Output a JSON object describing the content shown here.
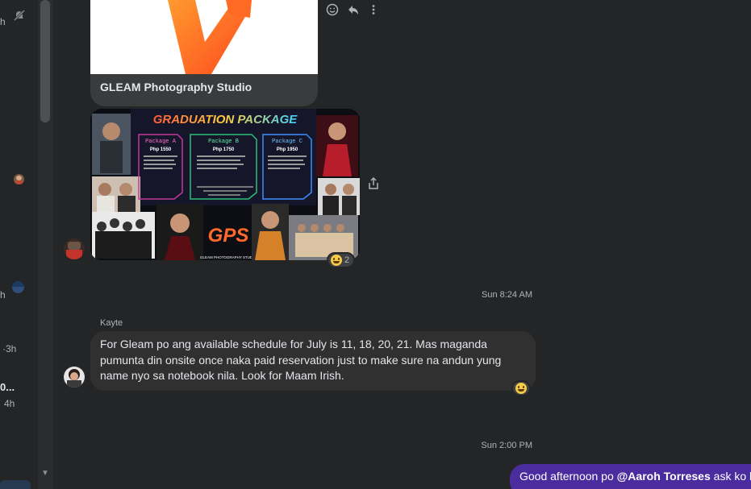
{
  "left_panel": {
    "items": [
      {
        "time": "h"
      },
      {
        "time": "h"
      },
      {
        "time": "·3h"
      },
      {
        "name": "0...",
        "time": "4h"
      }
    ]
  },
  "chat": {
    "link_card": {
      "title": "GLEAM Photography Studio"
    },
    "promo_image": {
      "title": "GRADUATION PACKAGE",
      "packages": [
        {
          "name": "Package A",
          "price": "Php 1550"
        },
        {
          "name": "Package B",
          "price": "Php 1750"
        },
        {
          "name": "Package C",
          "price": "Php 1950"
        }
      ],
      "logo": "GPS",
      "footer": "GLEAM PHOTOGRAPHY STUDIO"
    },
    "promo_reaction": {
      "count": "2"
    },
    "timestamp_1": "Sun 8:24 AM",
    "message": {
      "sender": "Kayte",
      "text": "For Gleam po ang available schedule for July is 11, 18, 20, 21. Mas maganda pumunta din onsite once naka paid reservation just to make sure na andun yung name nyo sa notebook nila. Look for Maam Irish."
    },
    "timestamp_2": "Sun 2:00 PM",
    "outgoing": {
      "prefix": "Good afternoon po ",
      "mention": "@Aaroh Torreses",
      "suffix": " ask ko la"
    }
  },
  "icons": {
    "mute": "bell-off-icon",
    "react": "smiley-icon",
    "reply": "reply-icon",
    "more": "more-vertical-icon",
    "share": "share-icon",
    "scroll_down": "triangle-down-icon"
  },
  "colors": {
    "background": "#242526",
    "bubble_incoming": "#303030",
    "bubble_outgoing": "#4a2c9f",
    "text_secondary": "#b0b3b8"
  }
}
